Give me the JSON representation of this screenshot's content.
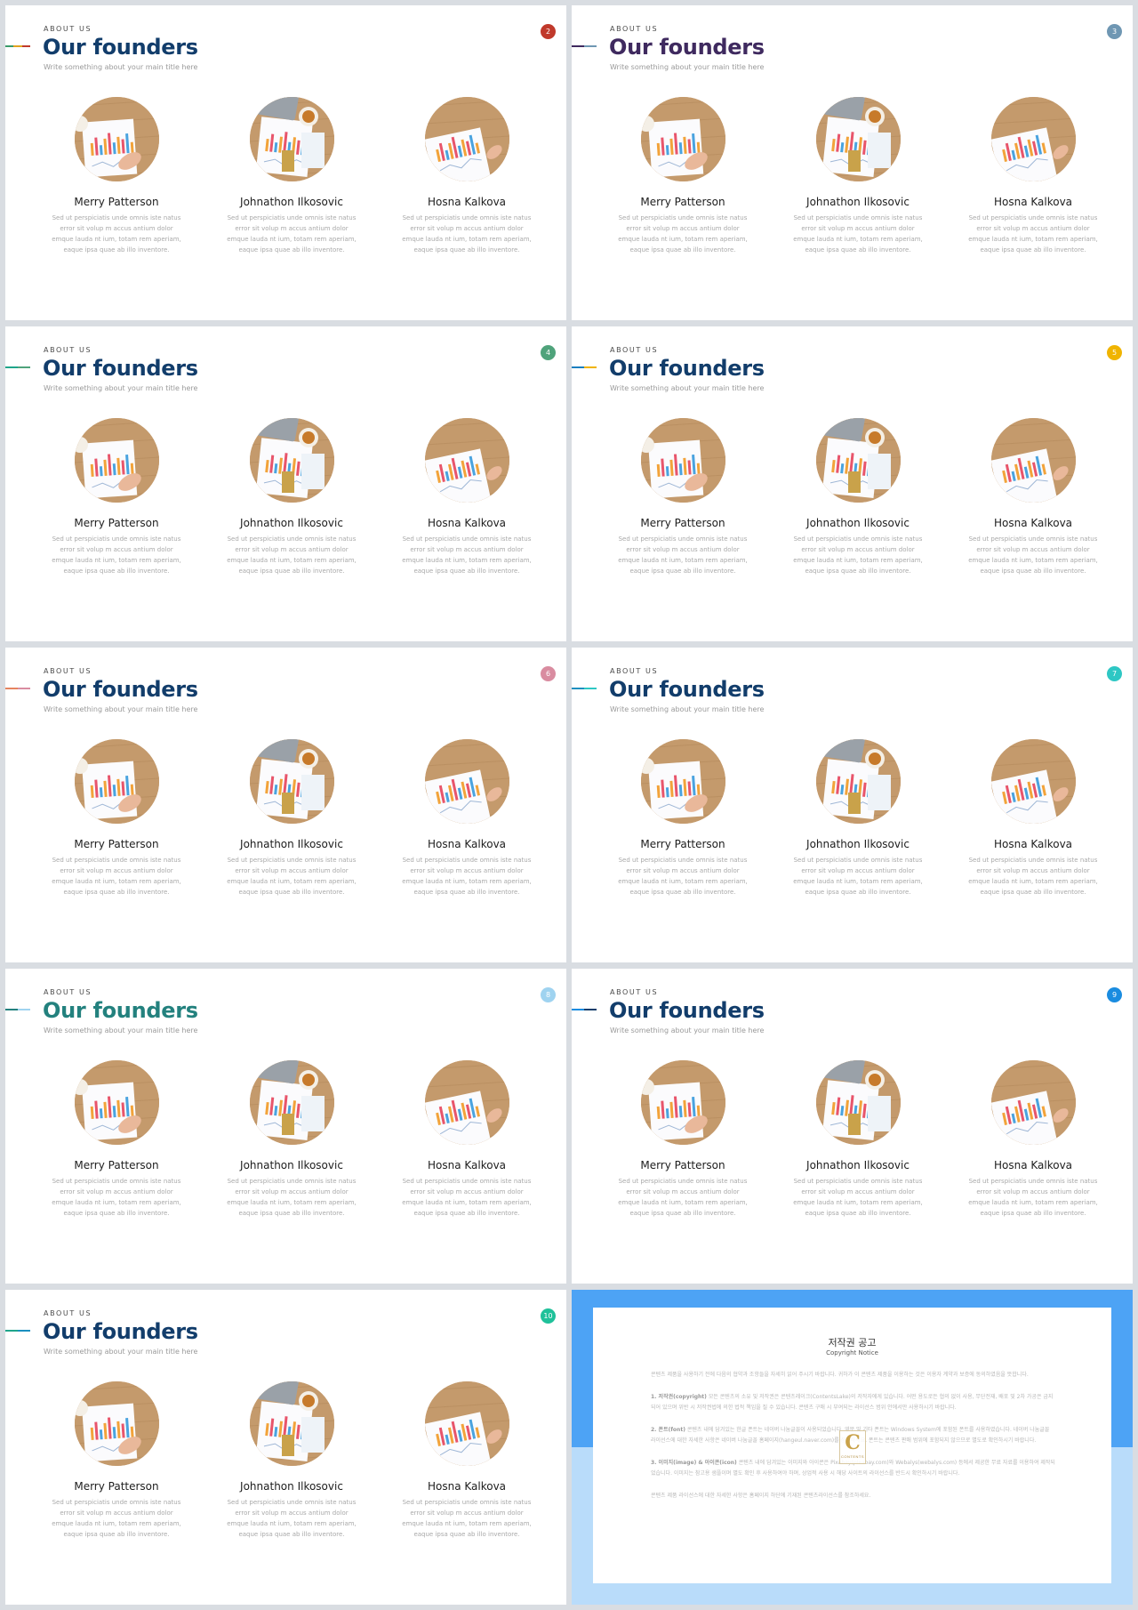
{
  "template": {
    "eyebrow": "ABOUT US",
    "title": "Our founders",
    "subtitle": "Write something about your main title here"
  },
  "people": [
    {
      "name": "Merry Patterson",
      "desc": "Sed ut perspiciatis unde omnis iste natus error sit volup m accus antium dolor emque lauda nt ium, totam rem aperiam, eaque ipsa quae ab illo inventore."
    },
    {
      "name": "Johnathon Ilkosovic",
      "desc": "Sed ut perspiciatis unde omnis iste natus error sit volup m accus antium dolor emque lauda nt ium, totam rem aperiam, eaque ipsa quae ab illo inventore."
    },
    {
      "name": "Hosna Kalkova",
      "desc": "Sed ut perspiciatis unde omnis iste natus error sit volup m accus antium dolor emque lauda nt ium, totam rem aperiam, eaque ipsa quae ab illo inventore."
    }
  ],
  "slides": [
    {
      "page": "2",
      "title_color": "#123d6b",
      "badge_color": "#c0392b",
      "accent": [
        "#3a9b6a",
        "#e1a320",
        "#c0392b"
      ]
    },
    {
      "page": "3",
      "title_color": "#3f2a5f",
      "badge_color": "#6f97b3",
      "accent": [
        "#3f2a5f",
        "#6f97b3"
      ]
    },
    {
      "page": "4",
      "title_color": "#123d6b",
      "badge_color": "#4fa37b",
      "accent": [
        "#1fa58a",
        "#4fa37b"
      ]
    },
    {
      "page": "5",
      "title_color": "#123d6b",
      "badge_color": "#f0b400",
      "accent": [
        "#1a7fbf",
        "#f0b400"
      ]
    },
    {
      "page": "6",
      "title_color": "#123d6b",
      "badge_color": "#d98ca0",
      "accent": [
        "#e6845f",
        "#d98ca0"
      ]
    },
    {
      "page": "7",
      "title_color": "#123d6b",
      "badge_color": "#2ec7c4",
      "accent": [
        "#1a8fbf",
        "#2ec7c4"
      ]
    },
    {
      "page": "8",
      "title_color": "#23817e",
      "badge_color": "#9fd3f0",
      "accent": [
        "#23817e",
        "#9fd3f0"
      ]
    },
    {
      "page": "9",
      "title_color": "#123d6b",
      "badge_color": "#1a8ce0",
      "accent": [
        "#1a8ce0",
        "#123d6b"
      ]
    },
    {
      "page": "10",
      "title_color": "#123d6b",
      "badge_color": "#1fc19a",
      "accent": [
        "#1fa58a",
        "#1a8fbf"
      ]
    }
  ],
  "copyright": {
    "title": "저작권 공고",
    "subtitle": "Copyright Notice",
    "intro": "콘텐츠 제품을 사용하기 전에 다음의 협약과 조항들을 자세히 읽어 주시기 바랍니다. 귀하가 이 콘텐츠 제품을 이용하는 것은 이용자 계약과 보증에 동의하였음을 뜻합니다.",
    "sections": [
      {
        "label": "1. 저작권(copyright)",
        "text": " 모든 콘텐츠의 소유 및 저작권은 콘텐츠레이크(ContentsLake)의 저작자에게 있습니다. 어떤 용도로든 협의 없이 사용, 무단전재, 배포 및 2차 가공은 금지되어 있으며 위반 시 저작권법에 의한 법적 책임을 질 수 있습니다. 콘텐츠 구매 시 부여되는 라이선스 범위 안에서만 사용하시기 바랍니다."
      },
      {
        "label": "2. 폰트(font)",
        "text": " 콘텐츠 내에 담겨있는 한글 폰트는 네이버 나눔글꼴이 사용되었습니다. 영문 및 기타 폰트는 Windows System에 포함된 폰트를 사용하였습니다. 네이버 나눔글꼴 라이선스에 대한 자세한 사항은 네이버 나눔글꼴 홈페이지(hangeul.naver.com)를 참조하세요. 폰트는 콘텐츠 판매 범위에 포함되지 않으므로 별도로 확인하시기 바랍니다."
      },
      {
        "label": "3. 이미지(image) & 아이콘(icon)",
        "text": " 콘텐츠 내에 담겨있는 이미지와 아이콘은 Pixabay(pixabay.com)와 Webalys(webalys.com) 등에서 제공한 무료 자료를 이용하여 제작되었습니다. 이미지는 참고용 샘플이며 별도 확인 후 사용하여야 하며, 상업적 사용 시 해당 사이트의 라이선스를 반드시 확인하시기 바랍니다."
      }
    ],
    "outro": "콘텐츠 제품 라이선스에 대한 자세한 사항은 홈페이지 하단에 기재된 콘텐츠라이선스를 참조하세요.",
    "logo_letter": "C",
    "logo_text": "CONTENTS"
  },
  "colors": {
    "name_text": "#1d1d1d",
    "desc_text": "#a9a9a9",
    "copy_top": "#4da3f5",
    "copy_bottom": "#b9dcfa"
  }
}
